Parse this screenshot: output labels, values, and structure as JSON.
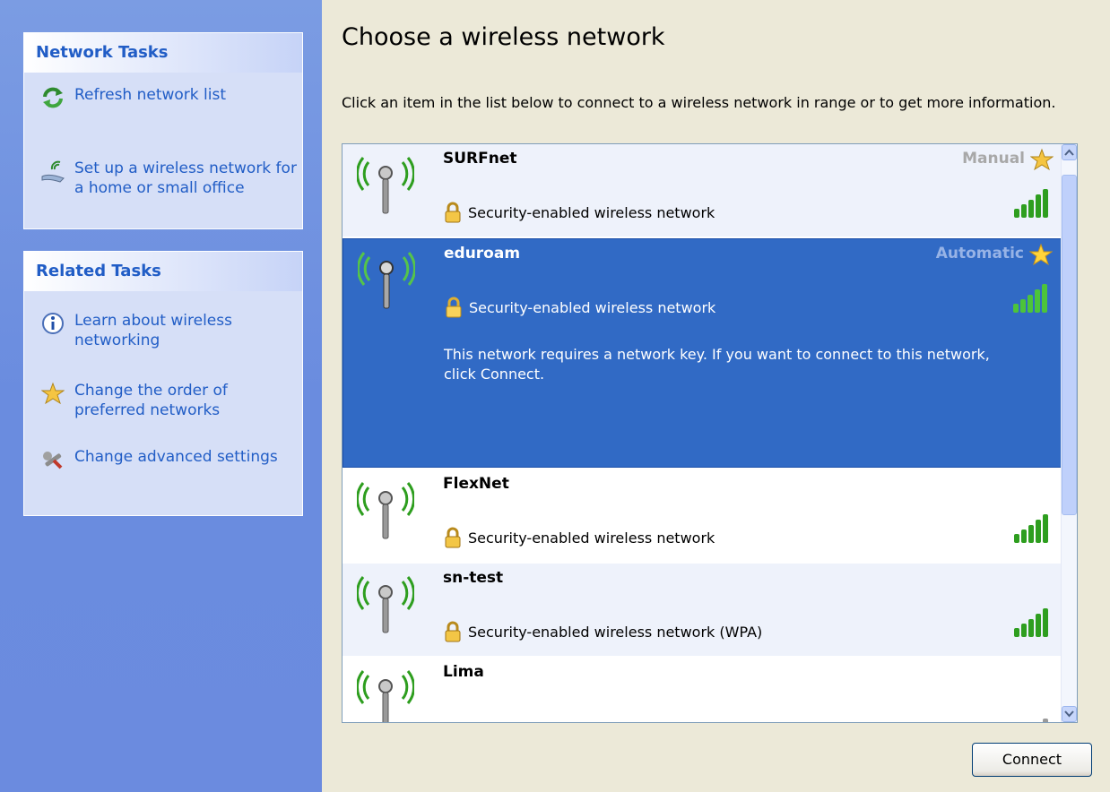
{
  "sidebar": {
    "network_tasks": {
      "title": "Network Tasks",
      "items": [
        {
          "label": "Refresh network list",
          "icon": "refresh-icon"
        },
        {
          "label": "Set up a wireless network for a home or small office",
          "icon": "wireless-setup-icon"
        }
      ]
    },
    "related_tasks": {
      "title": "Related Tasks",
      "items": [
        {
          "label": "Learn about wireless networking",
          "icon": "info-icon"
        },
        {
          "label": "Change the order of preferred networks",
          "icon": "star-icon"
        },
        {
          "label": "Change advanced settings",
          "icon": "settings-wrench-icon"
        }
      ]
    }
  },
  "main": {
    "title": "Choose a wireless network",
    "intro": "Click an item in the list below to connect to a wireless network in range or to get more information.",
    "networks": [
      {
        "name": "SURFnet",
        "mode": "Manual",
        "security": "Security-enabled wireless network",
        "selected": false
      },
      {
        "name": "eduroam",
        "mode": "Automatic",
        "security": "Security-enabled wireless network",
        "selected": true,
        "description": "This network requires a network key. If you want to connect to this network, click Connect."
      },
      {
        "name": "FlexNet",
        "mode": "",
        "security": "Security-enabled wireless network",
        "selected": false
      },
      {
        "name": "sn-test",
        "mode": "",
        "security": "Security-enabled wireless network (WPA)",
        "selected": false
      },
      {
        "name": "Lima",
        "mode": "",
        "security": "",
        "selected": false
      }
    ],
    "connect_label": "Connect"
  },
  "colors": {
    "accent": "#215DC6",
    "selection": "#316AC5",
    "sidebar": "#7B9CE3",
    "signal": "#2E9E1F"
  }
}
